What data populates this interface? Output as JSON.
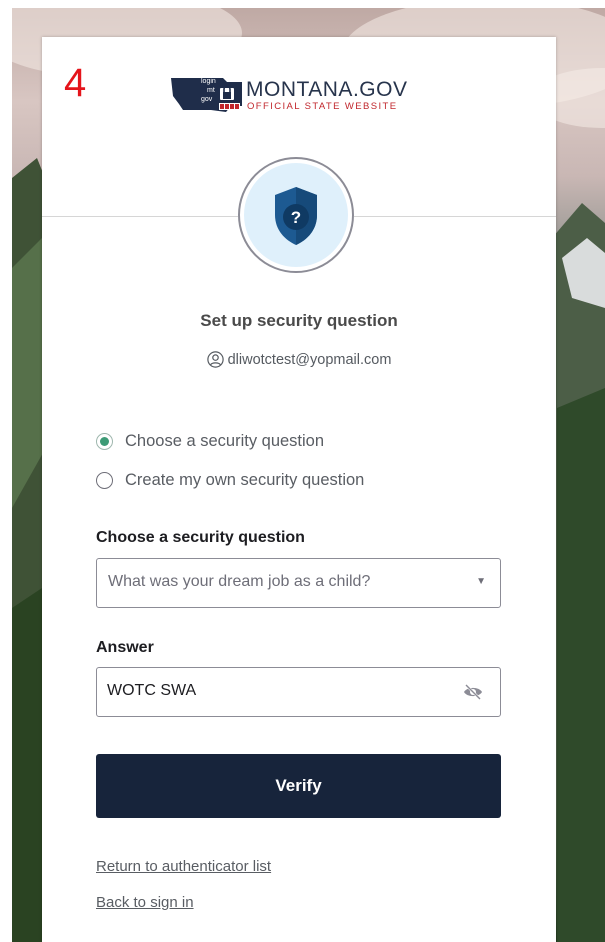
{
  "page_marker": "4",
  "logo": {
    "emblem_text_1": "login",
    "emblem_text_2": "mt",
    "emblem_text_3": "gov",
    "title": "MONTANA.GOV",
    "subtitle": "OFFICIAL STATE WEBSITE"
  },
  "header": {
    "icon": "shield-question-icon",
    "title": "Set up security question",
    "identity_icon": "user-circle-icon",
    "identity": "dliwotctest@yopmail.com"
  },
  "question_mode": {
    "options": [
      {
        "label": "Choose a security question",
        "checked": true
      },
      {
        "label": "Create my own security question",
        "checked": false
      }
    ]
  },
  "question_select": {
    "label": "Choose a security question",
    "selected": "What was your dream job as a child?"
  },
  "answer": {
    "label": "Answer",
    "value": "WOTC SWA",
    "toggle_icon": "eye-slash-icon"
  },
  "verify_label": "Verify",
  "links": {
    "return": "Return to authenticator list",
    "back": "Back to sign in"
  },
  "colors": {
    "button": "#17243b",
    "radio_checked": "#3d9b76",
    "shield": "#1d5a92",
    "marker": "#e5141b"
  }
}
